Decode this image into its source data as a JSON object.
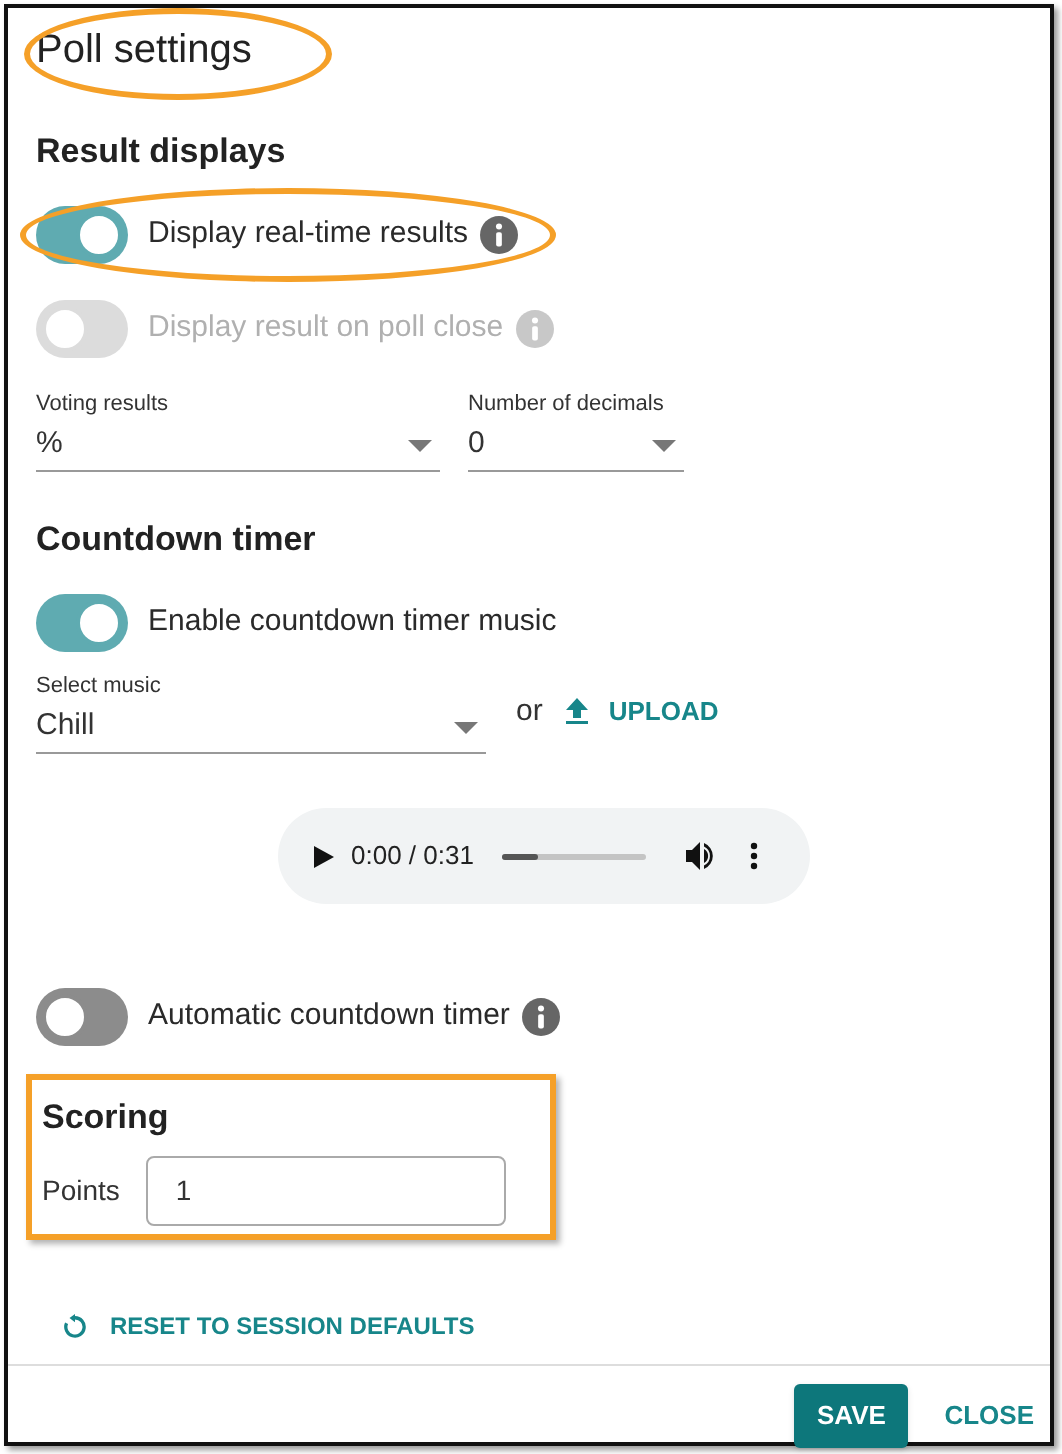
{
  "title": {
    "text": "Poll settings",
    "highlighted": true
  },
  "result_displays": {
    "heading": "Result displays",
    "toggles": [
      {
        "label": "Display real-time results",
        "on": true,
        "disabled": false,
        "info": true,
        "highlighted": true
      },
      {
        "label": "Display result on poll close",
        "on": false,
        "disabled": true,
        "info": true,
        "highlighted": false
      }
    ],
    "selects": [
      {
        "label": "Voting results",
        "value": "%"
      },
      {
        "label": "Number of decimals",
        "value": "0"
      }
    ]
  },
  "countdown_timer": {
    "heading": "Countdown timer",
    "music_toggle": {
      "label": "Enable countdown timer music",
      "on": true,
      "disabled": false,
      "info": false
    },
    "music_select": {
      "label": "Select music",
      "value": "Chill"
    },
    "or_text": "or",
    "upload": "UPLOAD",
    "player": {
      "time": "0:00 / 0:31",
      "level": 0.25
    },
    "auto_toggle": {
      "label": "Automatic countdown timer",
      "on": false,
      "disabled": false,
      "info": true
    }
  },
  "scoring": {
    "heading": "Scoring",
    "highlighted": true,
    "points_label": "Points",
    "points_value": "1"
  },
  "reset": "RESET TO SESSION DEFAULTS",
  "buttons": [
    {
      "label": "SAVE",
      "kind": "primary"
    },
    {
      "label": "CLOSE",
      "kind": "text"
    }
  ]
}
